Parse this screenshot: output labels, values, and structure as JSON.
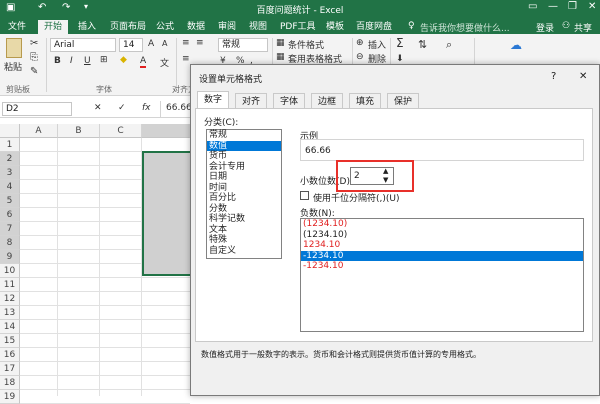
{
  "window": {
    "title": "百度问题统计 - Excel",
    "minimize": "—",
    "restore": "❐",
    "close": "✕"
  },
  "quick_access": {
    "undo": "↶",
    "redo": "↷"
  },
  "tabs": [
    "文件",
    "开始",
    "插入",
    "页面布局",
    "公式",
    "数据",
    "审阅",
    "视图",
    "PDF工具",
    "模板",
    "百度网盘"
  ],
  "active_tab": "开始",
  "search_placeholder": "告诉我你想要做什么...",
  "login": "登录",
  "share": "共享",
  "ribbon": {
    "paste": "粘贴",
    "clipboard_group": "剪贴板",
    "font_name": "Arial",
    "font_size": "14",
    "font_group": "字体",
    "bold": "B",
    "italic": "I",
    "underline": "U",
    "font_color": "A",
    "align_group_partial": "对齐方式",
    "number_format": "常规",
    "conditional_format": "条件格式",
    "table_format": "套用表格格式",
    "insert": "插入",
    "delete": "删除",
    "sigma": "Σ",
    "sort": "排序",
    "find": "查找"
  },
  "formula_bar": {
    "name_box": "D2",
    "cancel": "✕",
    "enter": "✓",
    "fx": "fx",
    "value": "66.66"
  },
  "columns": [
    "A",
    "B",
    "C"
  ],
  "rows": [
    "1",
    "2",
    "3",
    "4",
    "5",
    "6",
    "7",
    "8",
    "9",
    "10",
    "11",
    "12",
    "13",
    "14",
    "15",
    "16",
    "17",
    "18",
    "19"
  ],
  "dialog": {
    "title": "设置单元格格式",
    "help": "?",
    "close": "✕",
    "tabs": [
      "数字",
      "对齐",
      "字体",
      "边框",
      "填充",
      "保护"
    ],
    "active_tab": "数字",
    "category_label": "分类(C):",
    "categories": [
      "常规",
      "数值",
      "货币",
      "会计专用",
      "日期",
      "时间",
      "百分比",
      "分数",
      "科学记数",
      "文本",
      "特殊",
      "自定义"
    ],
    "selected_category": "数值",
    "sample_label": "示例",
    "sample_value": "66.66",
    "decimal_label": "小数位数(D):",
    "decimal_value": "2",
    "thousands_label": "使用千位分隔符(,)(U)",
    "negative_label": "负数(N):",
    "negatives": [
      {
        "text": "(1234.10)",
        "color": "#e02020",
        "selected": false
      },
      {
        "text": "(1234.10)",
        "color": "#222222",
        "selected": false
      },
      {
        "text": "1234.10",
        "color": "#e02020",
        "selected": false
      },
      {
        "text": "-1234.10",
        "color": "#ffffff",
        "selected": true
      },
      {
        "text": "-1234.10",
        "color": "#e02020",
        "selected": false
      }
    ],
    "description": "数值格式用于一般数字的表示。货币和会计格式则提供货币值计算的专用格式。"
  },
  "colors": {
    "excel_green": "#217346",
    "selection_blue": "#0078d7",
    "highlight_red": "#e02020"
  }
}
